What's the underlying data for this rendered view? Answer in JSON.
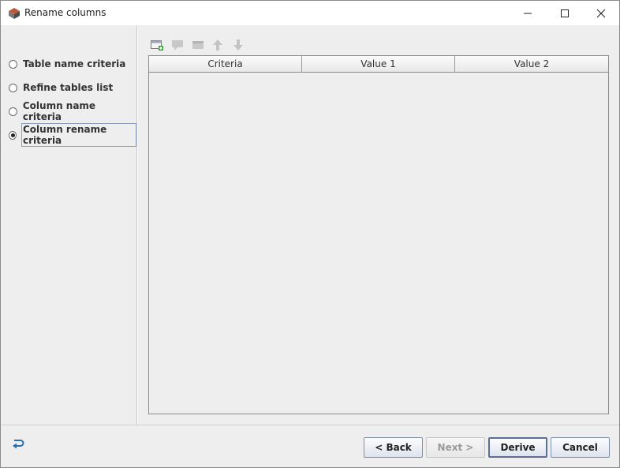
{
  "window": {
    "title": "Rename columns"
  },
  "left_panel": {
    "options": [
      {
        "label": "Table name criteria",
        "checked": false
      },
      {
        "label": "Refine tables list",
        "checked": false
      },
      {
        "label": "Column name criteria",
        "checked": false
      },
      {
        "label": "Column rename criteria",
        "checked": true
      }
    ]
  },
  "toolbar": {
    "icons": [
      "add-row-icon",
      "comment-icon",
      "delete-row-icon",
      "arrow-up-icon",
      "arrow-down-icon"
    ]
  },
  "table": {
    "columns": [
      "Criteria",
      "Value 1",
      "Value 2"
    ],
    "rows": []
  },
  "footer": {
    "back": {
      "pre": "< ",
      "mnemonic": "B",
      "post": "ack"
    },
    "next": {
      "pre": "",
      "mnemonic": "N",
      "post": "ext >"
    },
    "derive": {
      "pre": "",
      "mnemonic": "D",
      "post": "erive"
    },
    "cancel": {
      "pre": "",
      "mnemonic": "C",
      "post": "ancel"
    }
  },
  "colors": {
    "accent_border": "#5b6f94",
    "panel_bg": "#eeeeee",
    "green_add": "#2e9a2e"
  }
}
